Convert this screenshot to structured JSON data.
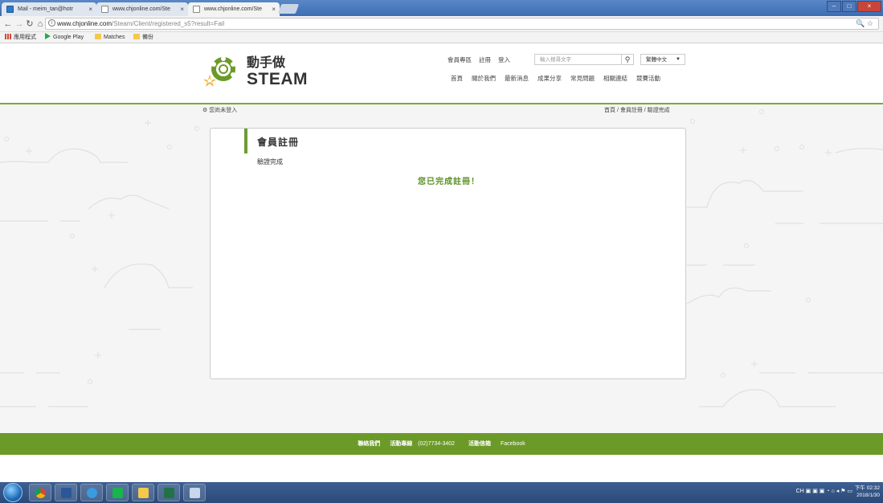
{
  "browser": {
    "tabs": [
      {
        "label": "Mail - meim_tan@hotr",
        "active": false
      },
      {
        "label": "www.chjonline.com/Ste",
        "active": false
      },
      {
        "label": "www.chjonline.com/Ste",
        "active": true
      }
    ],
    "url": {
      "host": "www.chjonline.com",
      "path": "/Steam/Client/registered_s5?result=Fail"
    },
    "bookmarks": [
      "應用程式",
      "Google Play",
      "Matches",
      "備份"
    ]
  },
  "header": {
    "logo_line1": "動手做",
    "logo_line2": "STEAM",
    "top_links": [
      "會員專區",
      "註冊",
      "登入"
    ],
    "search_placeholder": "輸入搜尋文字",
    "language": "繁體中文",
    "main_nav": [
      "首頁",
      "關於我們",
      "最新消息",
      "成果分享",
      "常見問題",
      "相關連結",
      "競賽活動"
    ]
  },
  "subbar": {
    "login_status": "您尚未登入",
    "breadcrumb": "首頁 / 會員註冊 / 驗證完成"
  },
  "card": {
    "title": "會員註冊",
    "step": "驗證完成",
    "message": "您已完成註冊！"
  },
  "footer": {
    "contact": "聯絡我們",
    "hotline_label": "活動專線",
    "hotline": "(02)7734-3402",
    "mailbox": "活動信箱",
    "facebook": "Facebook"
  },
  "taskbar": {
    "tray_text": "CH",
    "time": "下午 02:32",
    "date": "2018/1/30"
  },
  "colors": {
    "accent_green": "#6b9a28",
    "message_green": "#5b8f23",
    "tabstrip_blue": "#3c6eb4"
  }
}
